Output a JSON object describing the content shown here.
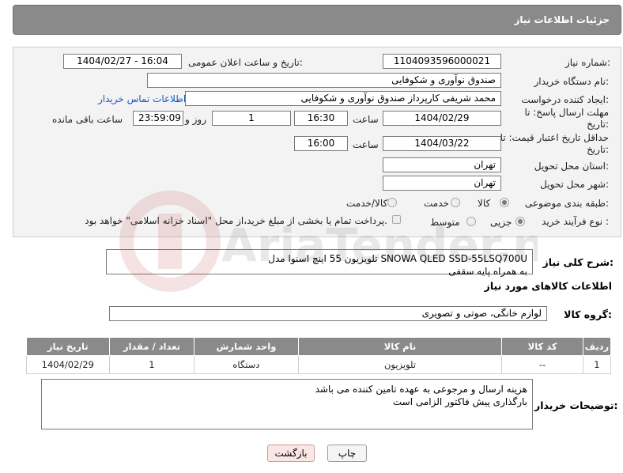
{
  "header": {
    "title": "جزئیات اطلاعات نیاز"
  },
  "form": {
    "need_number": {
      "label": "شماره نیاز:",
      "value": "1104093596000021"
    },
    "announce": {
      "label": "تاریخ و ساعت اعلان عمومی:",
      "value": "1404/02/27 - 16:04"
    },
    "buyer_org": {
      "label": "نام دستگاه خریدار:",
      "value": "صندوق نوآوری و شکوفایی"
    },
    "requester": {
      "label": "ایجاد کننده درخواست:",
      "value": "محمد  شریفی کارپرداز صندوق نوآوری و شکوفایی",
      "link": "اطلاعات تماس خریدار"
    },
    "deadline": {
      "label": "مهلت ارسال پاسخ: تا تاریخ:",
      "date": "1404/02/29",
      "time_label": "ساعت",
      "time": "16:30",
      "days": "1",
      "days_label": "روز و",
      "remaining": "23:59:09",
      "remaining_label": "ساعت باقی مانده"
    },
    "validity": {
      "label": "حداقل تاریخ اعتبار قیمت: تا تاریخ:",
      "date": "1404/03/22",
      "time_label": "ساعت",
      "time": "16:00"
    },
    "province": {
      "label": "استان محل تحویل:",
      "value": "تهران"
    },
    "city": {
      "label": "شهر محل تحویل:",
      "value": "تهران"
    },
    "category": {
      "label": "طبقه بندی موضوعی:",
      "options": [
        "کالا",
        "خدمت",
        "کالا/خدمت"
      ],
      "selected": "کالا"
    },
    "process": {
      "label": "نوع فرآیند خرید :",
      "options": [
        "جزیی",
        "متوسط"
      ],
      "selected": "جزیی",
      "checkbox_text": "پرداخت تمام یا بخشی از مبلغ خرید،از محل \"اسناد خزانه اسلامی\" خواهد بود."
    }
  },
  "description": {
    "label": "شرح کلی نیاز:",
    "value": "تلویزیون 55 اینچ اسنوا مدل SNOWA QLED SSD-55LSQ700U\nبه همراه پایه سقفی"
  },
  "goods": {
    "title": "اطلاعات کالاهای مورد نیاز",
    "group_label": "گروه کالا:",
    "group_value": "لوازم خانگی، صوتی و تصویری",
    "columns": [
      "ردیف",
      "کد کالا",
      "نام کالا",
      "واحد شمارش",
      "تعداد / مقدار",
      "تاریخ نیاز"
    ],
    "rows": [
      [
        "1",
        "--",
        "تلویزیون",
        "دستگاه",
        "1",
        "1404/02/29"
      ]
    ]
  },
  "buyer_notes": {
    "label": "توضیحات خریدار:",
    "value": "هزینه ارسال و مرجوعی به عهده تامین کننده می باشد\nبارگذاری پیش فاکتور الزامی است"
  },
  "buttons": {
    "print": "چاپ",
    "back": "بازگشت"
  },
  "watermark": {
    "text": "AriaTender.neT"
  }
}
